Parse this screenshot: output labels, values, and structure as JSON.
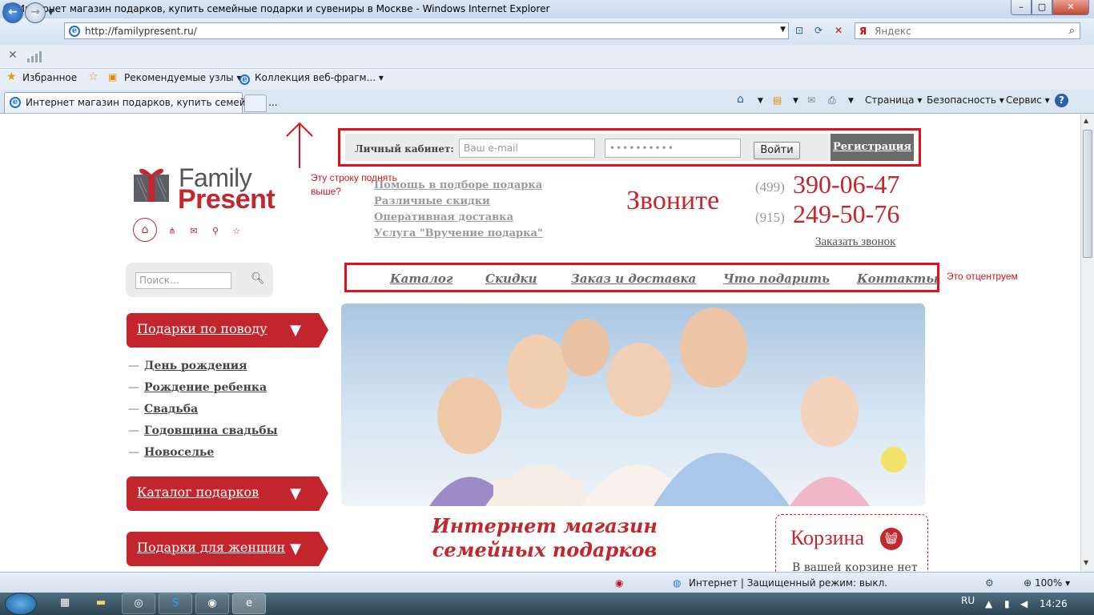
{
  "window": {
    "title": "Интернет магазин подарков, купить семейные подарки и сувениры в Москве - Windows Internet Explorer",
    "min": "–",
    "max": "▢",
    "close": "✕"
  },
  "nav": {
    "back": "←",
    "forward": "→",
    "url": "http://familypresent.ru/",
    "search_placeholder": "Яндекс",
    "search_brand": "Я"
  },
  "favorites": {
    "label": "Избранное",
    "items": [
      "Рекомендуемые узлы ▾",
      "Коллекция веб-фрагм... ▾"
    ]
  },
  "tabs": [
    {
      "label": "Интернет магазин подарков, купить семейные ..."
    }
  ],
  "commands": {
    "page": "Страница ▾",
    "security": "Безопасность ▾",
    "tools": "Сервис ▾",
    "help": "?"
  },
  "site": {
    "logo": {
      "line1": "Family",
      "line2": "Present"
    },
    "account": {
      "label": "Личный кабинет:",
      "email_placeholder": "Ваш e-mail",
      "password_mask": "••••••••••",
      "login": "Войти",
      "register": "Регистрация"
    },
    "annotations": {
      "top": "Эту строку поднять выше?",
      "menu": "Это отцентруем"
    },
    "services": [
      "Помощь в подборе подарка",
      "Различные скидки",
      "Оперативная доставка",
      "Услуга \"Вручение подарка\""
    ],
    "call": "Звоните",
    "phones": [
      {
        "code": "(499)",
        "number": "390-06-47"
      },
      {
        "code": "(915)",
        "number": "249-50-76"
      }
    ],
    "order_call": "Заказать звонок",
    "search_placeholder": "Поиск…",
    "menu": [
      "Каталог",
      "Скидки",
      "Заказ и доставка",
      "Что подарить",
      "Контакты"
    ],
    "categories": [
      {
        "title": "Подарки по поводу",
        "items": [
          "День рождения",
          "Рождение ребенка",
          "Свадьба",
          "Годовщина свадьбы",
          "Новоселье"
        ]
      },
      {
        "title": "Каталог подарков",
        "items": []
      },
      {
        "title": "Подарки для женщин",
        "items": []
      }
    ],
    "headline": "Интернет магазин семейных подарков",
    "cart": {
      "title": "Корзина",
      "text": "В вашей корзине нет"
    }
  },
  "status": {
    "zone": "Интернет | Защищенный режим: выкл.",
    "zoom": "100% ▾"
  },
  "taskbar": {
    "lang": "RU",
    "time": "14:26"
  },
  "colors": {
    "brand_red": "#c2272d",
    "annotation_red": "#e0111d"
  }
}
